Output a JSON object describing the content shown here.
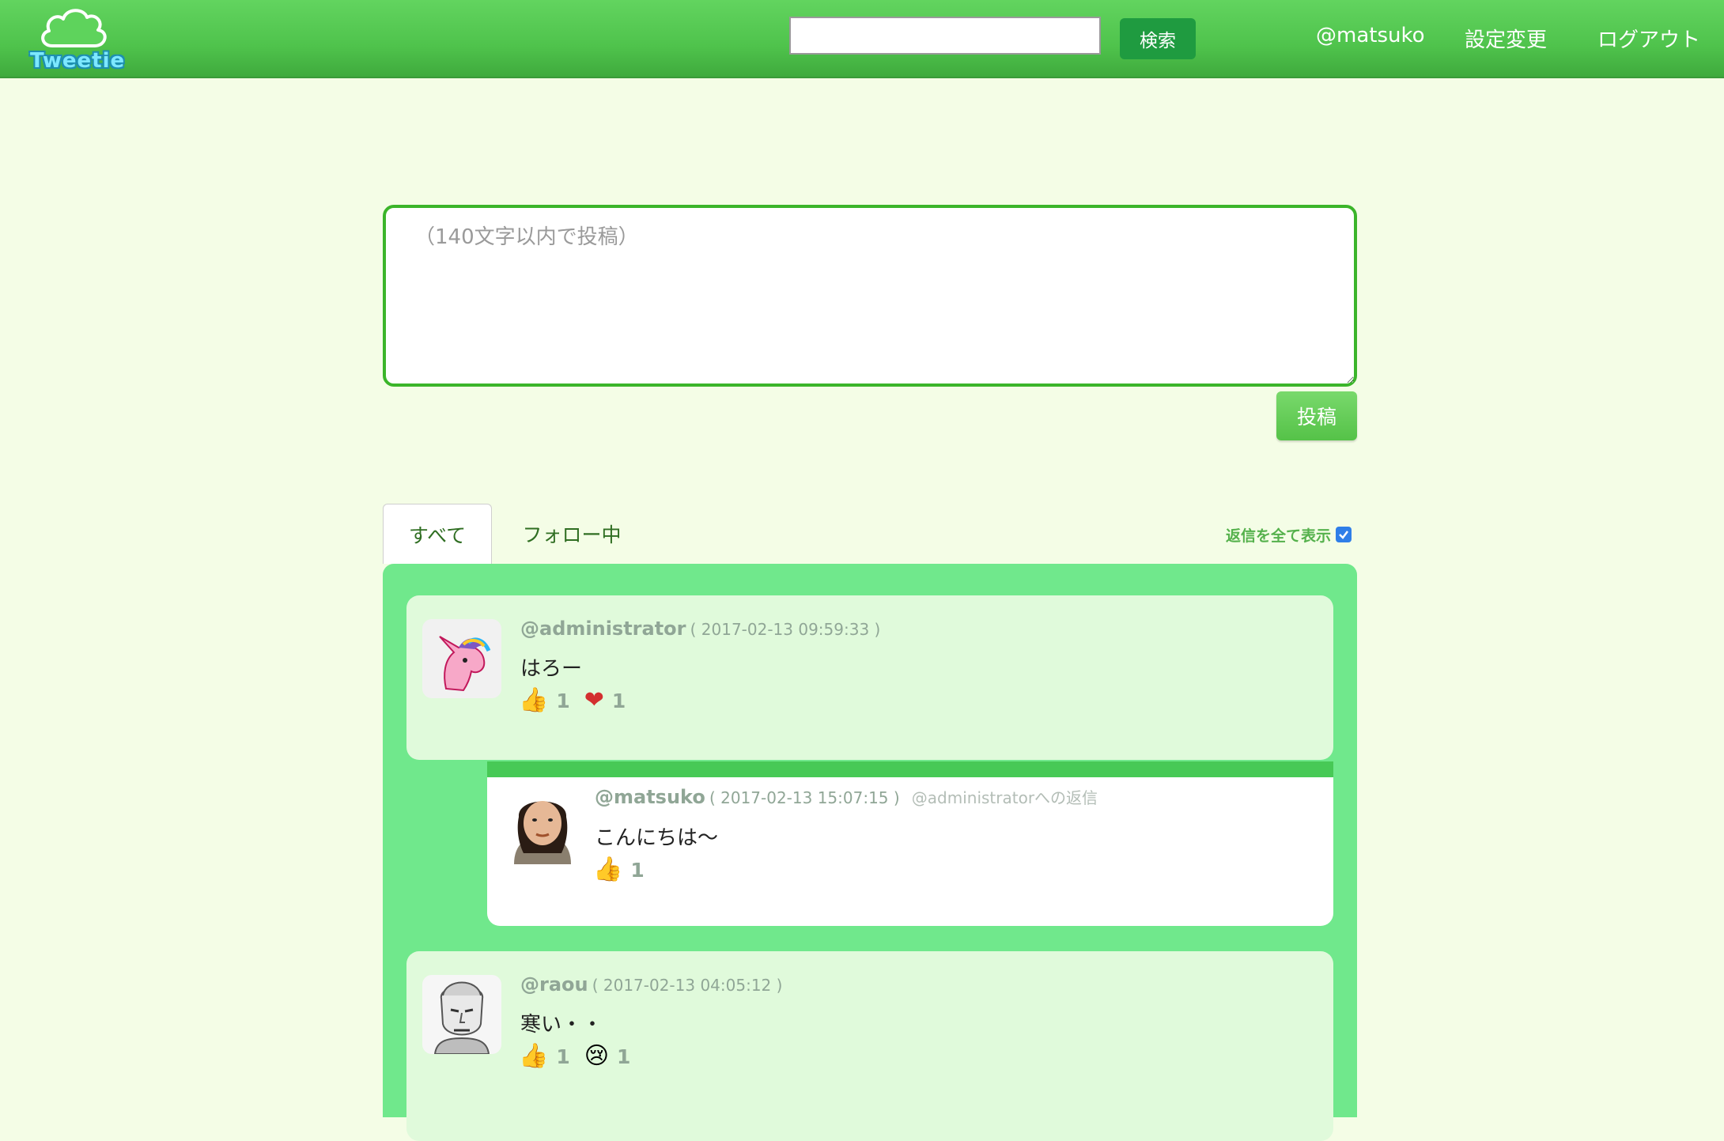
{
  "app": {
    "logo_text": "Tweetie"
  },
  "header": {
    "search": {
      "value": "",
      "placeholder": ""
    },
    "search_button": "検索",
    "nav": {
      "user": "@matsuko",
      "settings": "設定変更",
      "logout": "ログアウト"
    }
  },
  "compose": {
    "placeholder": "（140文字以内で投稿）",
    "submit": "投稿"
  },
  "tabs": [
    {
      "label": "すべて",
      "active": true
    },
    {
      "label": "フォロー中",
      "active": false
    }
  ],
  "show_all_replies": {
    "label": "返信を全て表示",
    "checked": true
  },
  "posts": [
    {
      "username": "@administrator",
      "timestamp": "( 2017-02-13 09:59:33 )",
      "text": "はろー",
      "avatar": "unicorn-avatar",
      "reactions": [
        {
          "icon": "thumbs-up-icon",
          "count": "1"
        },
        {
          "icon": "heart-icon",
          "count": "1"
        }
      ]
    },
    {
      "username": "@matsuko",
      "timestamp": "( 2017-02-13 15:07:15 )",
      "reply_to": "@administratorへの返信",
      "text": "こんにちは〜",
      "avatar": "matsuko-avatar",
      "reactions": [
        {
          "icon": "thumbs-up-icon",
          "count": "1"
        }
      ]
    },
    {
      "username": "@raou",
      "timestamp": "( 2017-02-13 04:05:12 )",
      "text": "寒い・・",
      "avatar": "raou-avatar",
      "reactions": [
        {
          "icon": "thumbs-up-icon",
          "count": "1"
        },
        {
          "icon": "crying-face-icon",
          "count": "1"
        }
      ]
    }
  ],
  "colors": {
    "header": "#4fc34c",
    "background": "#f4fde6",
    "timeline": "#70e88c",
    "card": "#e0fadb",
    "accent": "#3bb52a"
  }
}
